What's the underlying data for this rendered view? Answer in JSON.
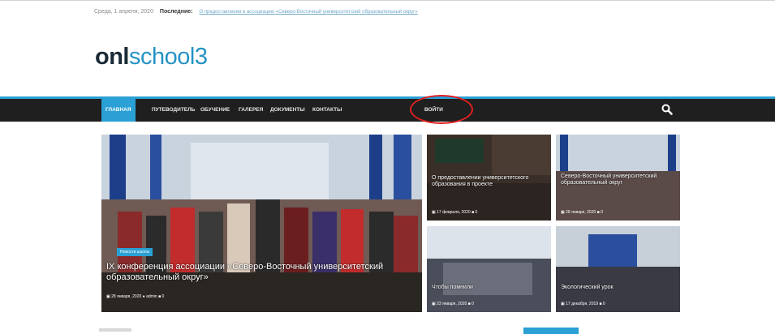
{
  "topbar": {
    "date": "Среда, 1 апреля, 2020",
    "latest_label": "Последние:",
    "latest_news": "О предоставлении в ассоциацию «Северо-Восточный университетский образовательный округ»"
  },
  "logo": {
    "part1": "onl",
    "part2": "school3"
  },
  "nav": {
    "items": [
      "ГЛАВНАЯ",
      "ПУТЕВОДИТЕЛЬ",
      "ОБУЧЕНИЕ",
      "ГАЛЕРЕЯ",
      "ДОКУМЕНТЫ",
      "КОНТАКТЫ",
      "ВОЙТИ"
    ],
    "search_icon": "search-icon"
  },
  "featured": {
    "badge": "Новости школы",
    "title": "IX конференция ассоциации «Северо-Восточный университетский образовательный округ»",
    "date": "28 января, 2020",
    "author": "admin",
    "comments": "0"
  },
  "tiles": [
    {
      "title": "О предоставлении университетского образования в проекте",
      "date": "17 февраля, 2020",
      "comments": "0"
    },
    {
      "title": "Северо-Восточный университетский образовательный округ",
      "date": "28 января, 2020",
      "comments": "0"
    },
    {
      "title": "Чтобы помнили",
      "date": "23 января, 2020",
      "comments": "0"
    },
    {
      "title": "Экологический урок",
      "date": "17 декабря, 2019",
      "comments": "0"
    }
  ],
  "colors": {
    "accent": "#2aa0d4",
    "nav_bg": "#1f1f1f",
    "highlight": "#e02020"
  }
}
